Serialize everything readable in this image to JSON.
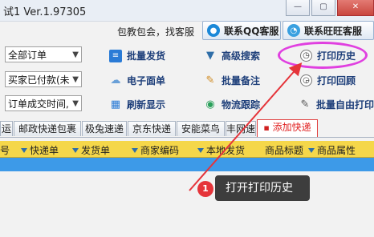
{
  "window": {
    "title": "试1 Ver.1.97305",
    "min_glyph": "—",
    "max_glyph": "▢",
    "close_glyph": "✕"
  },
  "service": {
    "promo": "包教包会，找客服",
    "qq_label": "联系QQ客服",
    "ww_label": "联系旺旺客服"
  },
  "filters": {
    "order_scope": "全部订单",
    "payment": "买家已付款(未",
    "time_field": "订单成交时间,"
  },
  "toolbar": {
    "batch_ship": "批量发货",
    "eface": "电子面单",
    "refresh": "刷新显示",
    "adv_search": "高级搜索",
    "batch_note": "批量备注",
    "tracking": "物流跟踪",
    "print_history": "打印历史",
    "print_back": "打印回顾",
    "free_print": "批量自由打印"
  },
  "tabs": [
    "运",
    "邮政快递包裹",
    "极兔速递",
    "京东快递",
    "安能菜鸟",
    "丰网速",
    "添加快递"
  ],
  "columns": [
    "号",
    "快递单",
    "发货单",
    "商家编码",
    "本地发货",
    "商品标题",
    "商品属性"
  ],
  "annotation": {
    "step": "1",
    "text": "打开打印历史"
  },
  "colors": {
    "header_yellow": "#f5d74a",
    "selection_blue": "#3d9ae8",
    "highlight_magenta": "#e040e0",
    "arrow_red": "#e5343a",
    "link_blue": "#1e3f7a"
  }
}
